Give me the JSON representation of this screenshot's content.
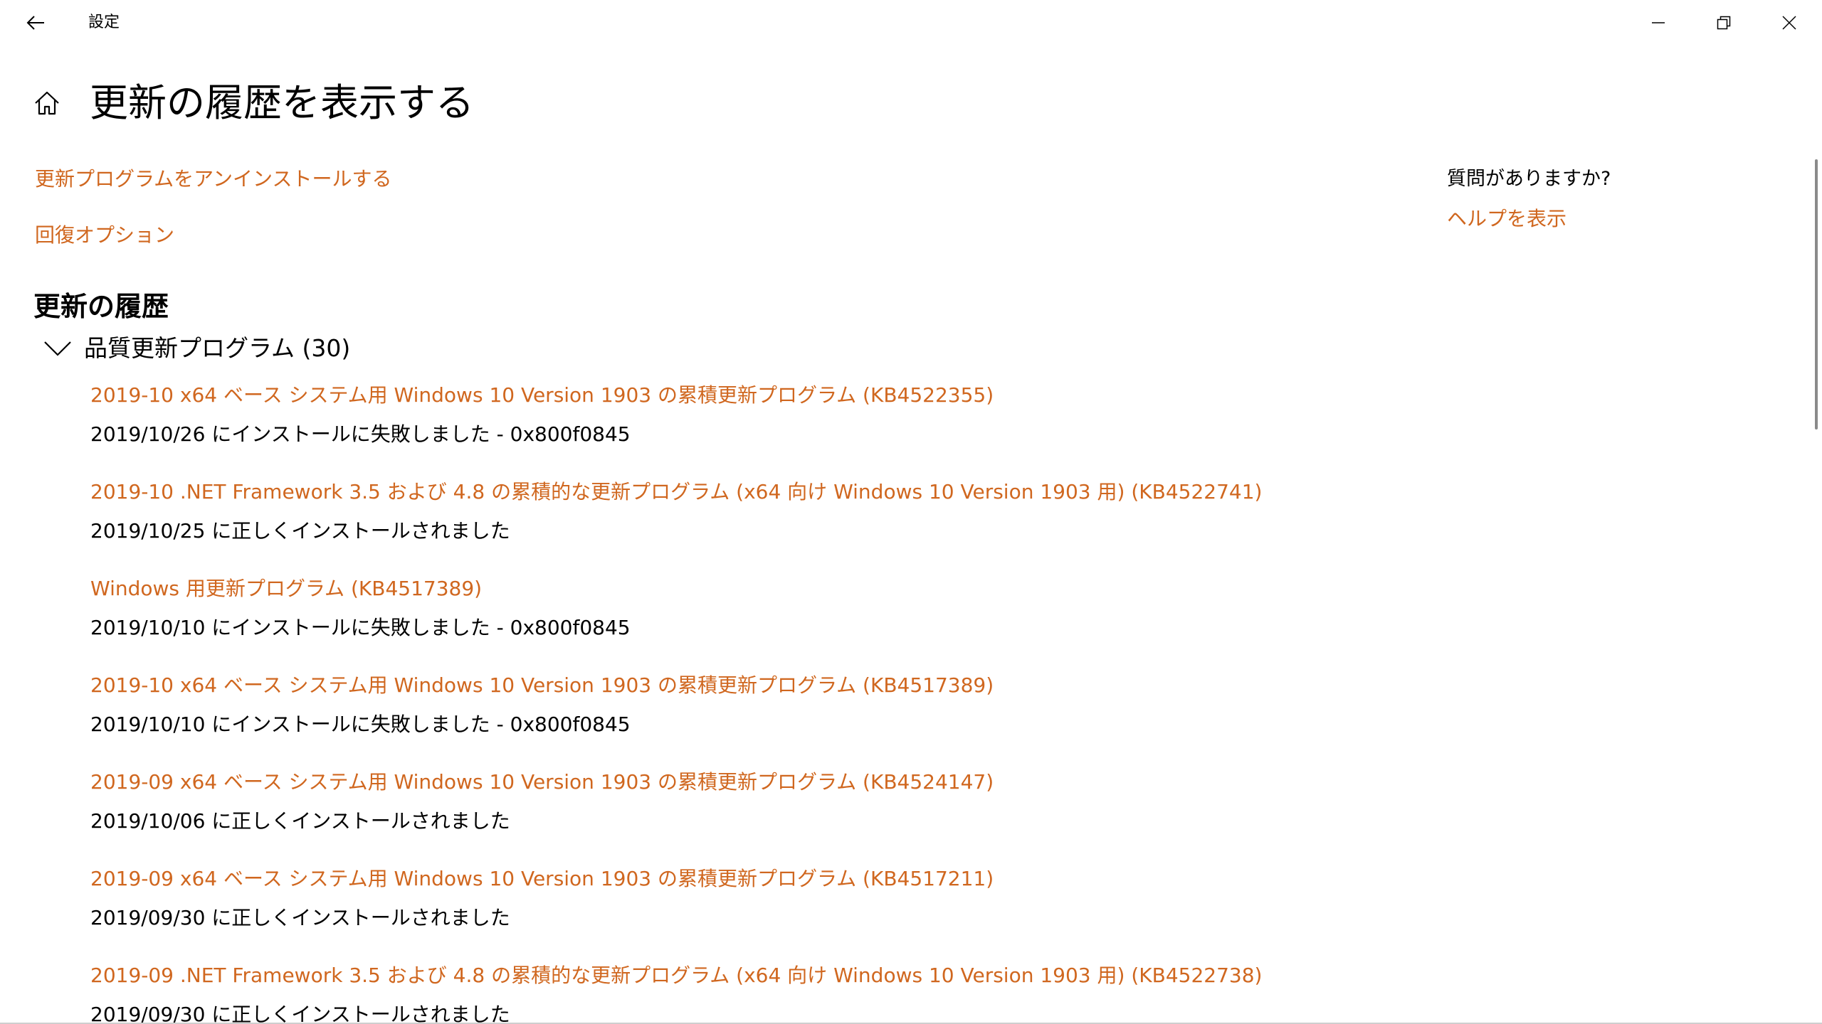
{
  "titlebar": {
    "app_title": "設定",
    "icons": {
      "back": "arrow-left-icon",
      "minimize": "minimize-icon",
      "restore": "restore-icon",
      "close": "close-icon"
    }
  },
  "header": {
    "title": "更新の履歴を表示する",
    "icon": "home-icon"
  },
  "links": {
    "uninstall": "更新プログラムをアンインストールする",
    "recovery": "回復オプション"
  },
  "help": {
    "question": "質問がありますか?",
    "link": "ヘルプを表示"
  },
  "history": {
    "section_title": "更新の履歴",
    "category_label": "品質更新プログラム (30)",
    "category_expanded": true,
    "items": [
      {
        "name": "2019-10 x64 ベース システム用 Windows 10 Version 1903 の累積更新プログラム (KB4522355)",
        "status": "2019/10/26 にインストールに失敗しました - 0x800f0845"
      },
      {
        "name": "2019-10 .NET Framework 3.5 および 4.8 の累積的な更新プログラム (x64 向け Windows 10 Version 1903 用) (KB4522741)",
        "status": "2019/10/25 に正しくインストールされました"
      },
      {
        "name": "Windows 用更新プログラム (KB4517389)",
        "status": "2019/10/10 にインストールに失敗しました - 0x800f0845"
      },
      {
        "name": "2019-10 x64 ベース システム用 Windows 10 Version 1903 の累積更新プログラム (KB4517389)",
        "status": "2019/10/10 にインストールに失敗しました - 0x800f0845"
      },
      {
        "name": "2019-09 x64 ベース システム用 Windows 10 Version 1903 の累積更新プログラム (KB4524147)",
        "status": "2019/10/06 に正しくインストールされました"
      },
      {
        "name": "2019-09 x64 ベース システム用 Windows 10 Version 1903 の累積更新プログラム (KB4517211)",
        "status": "2019/09/30 に正しくインストールされました"
      },
      {
        "name": "2019-09 .NET Framework 3.5 および 4.8 の累積的な更新プログラム (x64 向け Windows 10 Version 1903 用) (KB4522738)",
        "status": "2019/09/30 に正しくインストールされました"
      }
    ]
  },
  "colors": {
    "accent_link": "#d0671f",
    "text": "#000000",
    "background": "#ffffff"
  }
}
